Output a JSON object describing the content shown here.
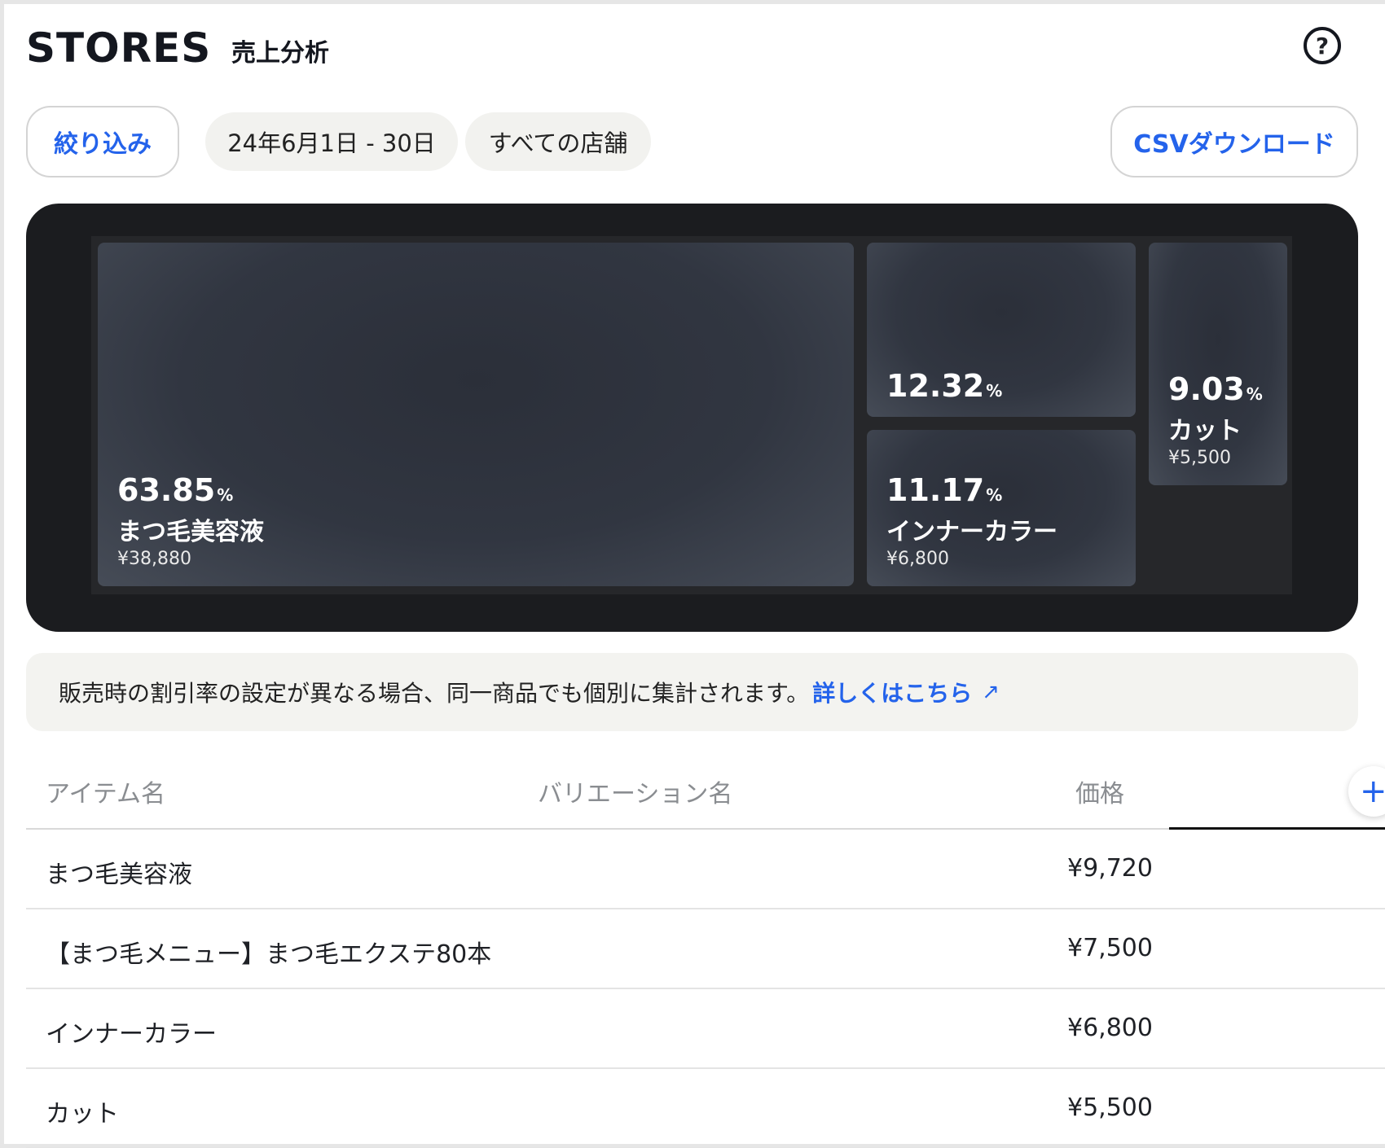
{
  "header": {
    "logo": "STORES",
    "title": "売上分析",
    "help_icon": "question-circle-icon"
  },
  "filters": {
    "filter_label": "絞り込み",
    "date_range": "24年6月1日 - 30日",
    "store": "すべての店舗",
    "csv_label": "CSVダウンロード"
  },
  "treemap": {
    "tiles": [
      {
        "pct": "63.85",
        "pct_unit": "%",
        "name": "まつ毛美容液",
        "amount": "¥38,880"
      },
      {
        "pct": "12.32",
        "pct_unit": "%",
        "name": "",
        "amount": ""
      },
      {
        "pct": "11.17",
        "pct_unit": "%",
        "name": "インナーカラー",
        "amount": "¥6,800"
      },
      {
        "pct": "9.03",
        "pct_unit": "%",
        "name": "カット",
        "amount": "¥5,500"
      }
    ]
  },
  "notice": {
    "text": "販売時の割引率の設定が異なる場合、同一商品でも個別に集計されます。",
    "link": "詳しくはこちら",
    "link_icon": "external-link-icon",
    "link_glyph": "↗"
  },
  "table": {
    "columns": [
      "アイテム名",
      "バリエーション名",
      "価格"
    ],
    "add_column_icon": "plus-icon",
    "add_glyph": "+",
    "rows": [
      {
        "name": "まつ毛美容液",
        "variation": "",
        "price": "¥9,720"
      },
      {
        "name": "【まつ毛メニュー】まつ毛エクステ80本",
        "variation": "",
        "price": "¥7,500"
      },
      {
        "name": "インナーカラー",
        "variation": "",
        "price": "¥6,800"
      },
      {
        "name": "カット",
        "variation": "",
        "price": "¥5,500"
      }
    ]
  }
}
